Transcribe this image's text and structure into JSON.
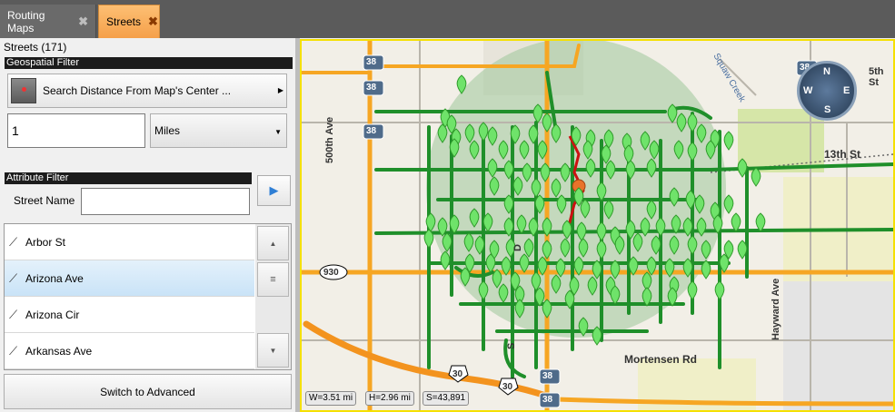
{
  "tabs": [
    {
      "label": "Routing Maps",
      "close": "✖"
    },
    {
      "label": "Streets",
      "close": "✖"
    }
  ],
  "panel": {
    "count_label": "Streets (171)",
    "geospatial_header": "Geospatial Filter",
    "search_button": "Search Distance From Map's Center ...",
    "distance_value": "1",
    "units_value": "Miles",
    "attribute_header": "Attribute Filter",
    "street_name_label": "Street Name",
    "street_name_value": "",
    "streets": [
      {
        "name": "Arbor St",
        "selected": false
      },
      {
        "name": "Arizona Ave",
        "selected": true
      },
      {
        "name": "Arizona Cir",
        "selected": false
      },
      {
        "name": "Arkansas Ave",
        "selected": false
      }
    ],
    "advanced_button": "Switch to Advanced"
  },
  "map": {
    "compass": {
      "n": "N",
      "s": "S",
      "e": "E",
      "w": "W"
    },
    "route_shields": [
      "38",
      "38",
      "38",
      "38",
      "38",
      "38"
    ],
    "hwy_930": "930",
    "us_30": "30",
    "labels": {
      "ave_500": "500th Ave",
      "st_13": "13th St",
      "mortensen": "Mortensen Rd",
      "hayward": "Hayward Ave",
      "squaw": "Squaw Creek",
      "st_5th": "5th St",
      "ave_s": "S",
      "ave_d": "D"
    },
    "status": {
      "width": "W=3.51 mi",
      "height": "H=2.96 mi",
      "scale": "S=43,891"
    },
    "colors": {
      "street": "#1f8f2a",
      "marker": "#6fe36a",
      "route": "#cc1111",
      "buffer": "#9fc79a",
      "highway": "#f6a623"
    }
  }
}
